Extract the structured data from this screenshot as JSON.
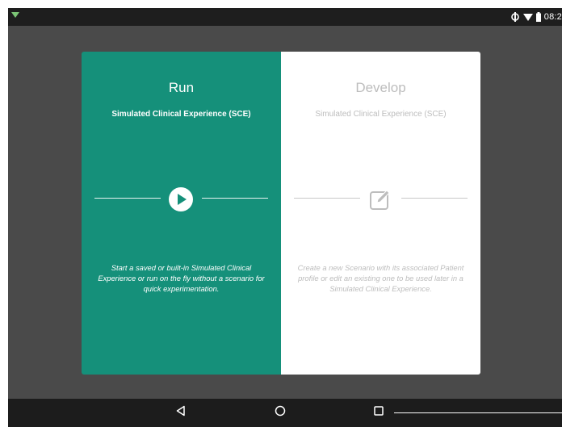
{
  "status_bar": {
    "time": "08:2",
    "icons": [
      "notification-icon",
      "data-sync-icon",
      "wifi-icon",
      "battery-icon"
    ]
  },
  "run_panel": {
    "title": "Run",
    "subtitle": "Simulated Clinical Experience (SCE)",
    "icon": "play-icon",
    "description": "Start a saved or built-in Simulated Clinical Experience or run on the fly without a scenario for quick experimentation.",
    "color": "#15907a"
  },
  "develop_panel": {
    "title": "Develop",
    "subtitle": "Simulated Clinical Experience (SCE)",
    "icon": "edit-icon",
    "description": "Create a new Scenario with its associated Patient profile or edit an existing one to be used later in a Simulated Clinical Experience.",
    "color": "#ffffff"
  },
  "nav_bar": {
    "buttons": [
      "back-icon",
      "home-icon",
      "recent-apps-icon"
    ]
  }
}
